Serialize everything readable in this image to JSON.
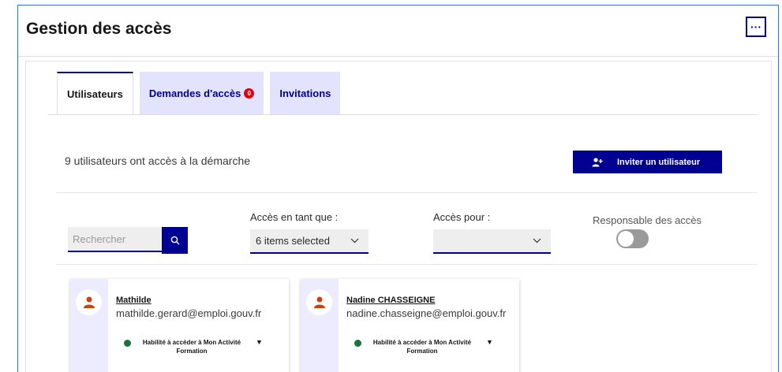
{
  "header": {
    "title": "Gestion des accès",
    "more_label": "···"
  },
  "tabs": [
    {
      "label": "Utilisateurs",
      "active": true
    },
    {
      "label": "Demandes d'accès",
      "badge": "0"
    },
    {
      "label": "Invitations"
    }
  ],
  "summary": {
    "count_text": "9 utilisateurs ont accès à la démarche"
  },
  "actions": {
    "invite_label": "Inviter un utilisateur"
  },
  "filters": {
    "search_placeholder": "Rechercher",
    "access_as_label": "Accès en tant que :",
    "access_as_value": "6 items selected",
    "access_for_label": "Accès pour :",
    "access_for_value": "",
    "manager_label": "Responsable des accès",
    "manager_on": false
  },
  "users": [
    {
      "name": "Mathilde",
      "email": "mathilde.gerard@emploi.gouv.fr",
      "role": "Habilité à accéder à Mon Activité Formation",
      "status_color": "#18753c"
    },
    {
      "name": "Nadine CHASSEIGNE",
      "email": "nadine.chasseigne@emploi.gouv.fr",
      "role": "Habilité à accéder à Mon Activité Formation",
      "status_color": "#18753c"
    }
  ],
  "colors": {
    "primary": "#000091",
    "badge": "#e1000f",
    "avatar": "#c9430c",
    "status_ok": "#18753c"
  }
}
